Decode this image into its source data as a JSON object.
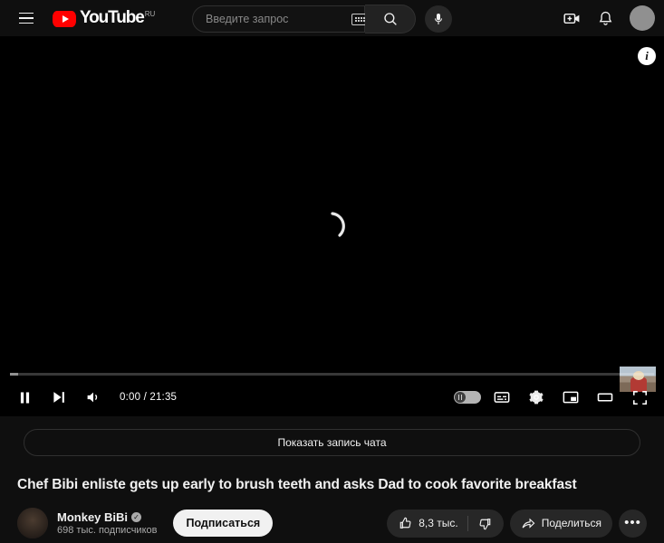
{
  "masthead": {
    "menu_icon": "hamburger-icon",
    "logo_text": "YouTube",
    "logo_country": "RU",
    "search_placeholder": "Введите запрос",
    "search_value": "",
    "search_icon": "search-icon",
    "keyboard_icon": "keyboard-icon",
    "mic_icon": "microphone-icon",
    "create_icon": "create-video-icon",
    "notifications_icon": "bell-icon",
    "avatar": "account-avatar"
  },
  "player": {
    "info_badge": "i",
    "state": "loading",
    "spinner_icon": "loading-spinner",
    "play_pause_icon": "pause-icon",
    "next_icon": "next-video-icon",
    "volume_icon": "volume-icon",
    "time_current": "0:00",
    "time_total": "21:35",
    "time_display": "0:00 / 21:35",
    "progress_played_pct": 0,
    "progress_loaded_pct": 1.3,
    "autoplay_icon": "autoplay-toggle",
    "subtitles_icon": "subtitles-icon",
    "settings_icon": "gear-icon",
    "miniplayer_icon": "miniplayer-icon",
    "theater_icon": "theater-mode-icon",
    "fullscreen_icon": "fullscreen-icon",
    "preview_thumbnail": "video-preview-thumbnail"
  },
  "below": {
    "chat_replay_label": "Показать запись чата",
    "video_title": "Chef Bibi enliste gets up early to brush teeth and asks Dad to cook favorite breakfast",
    "channel_name": "Monkey BiBi",
    "verified_glyph": "✓",
    "subscriber_count": "698 тыс. подписчиков",
    "subscribe_label": "Подписаться",
    "like_count": "8,3 тыс.",
    "like_icon": "thumbs-up-icon",
    "dislike_icon": "thumbs-down-icon",
    "share_label": "Поделиться",
    "share_icon": "share-arrow-icon",
    "more_label": "•••",
    "more_icon": "more-options-icon"
  },
  "colors": {
    "brand_red": "#ff0000",
    "page_bg": "#0f0f0f",
    "player_bg": "#000000",
    "pill_bg": "#272727",
    "text_primary": "#f1f1f1",
    "text_secondary": "#aaaaaa"
  }
}
